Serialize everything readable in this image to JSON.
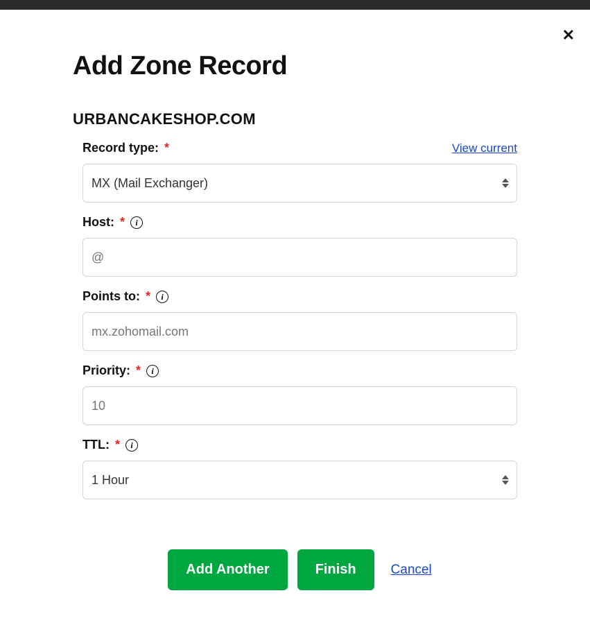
{
  "title": "Add Zone Record",
  "domain": "URBANCAKESHOP.COM",
  "links": {
    "view_current": "View current",
    "cancel": "Cancel"
  },
  "buttons": {
    "add_another": "Add Another",
    "finish": "Finish"
  },
  "fields": {
    "record_type": {
      "label": "Record type:",
      "value": "MX (Mail Exchanger)"
    },
    "host": {
      "label": "Host:",
      "value": "@"
    },
    "points_to": {
      "label": "Points to:",
      "value": "mx.zohomail.com"
    },
    "priority": {
      "label": "Priority:",
      "value": "10"
    },
    "ttl": {
      "label": "TTL:",
      "value": "1 Hour"
    }
  },
  "info_glyph": "i"
}
